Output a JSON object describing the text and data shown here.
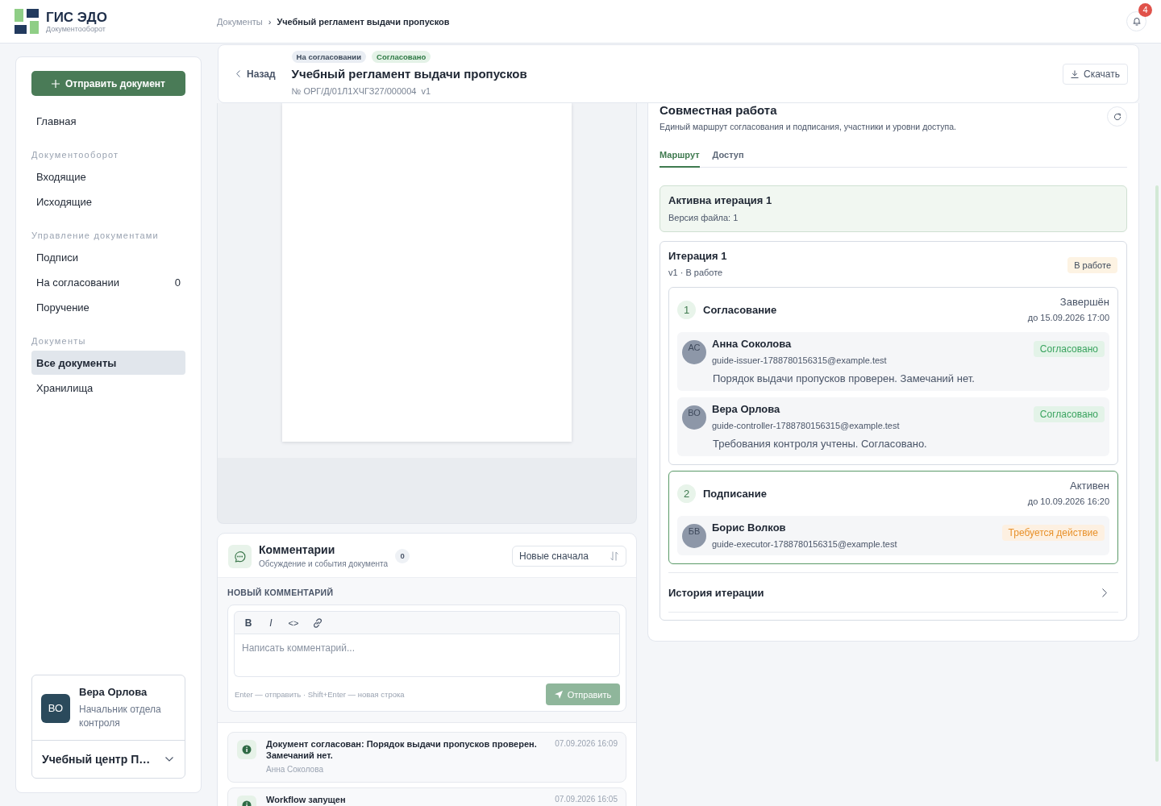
{
  "header": {
    "app_name": "ГИС ЭДО",
    "app_subtitle": "Документооборот",
    "breadcrumbs": [
      {
        "kind": "link",
        "label": "Документы"
      },
      {
        "kind": "separator",
        "label": "›"
      },
      {
        "kind": "current",
        "label": "Учебный регламент выдачи пропусков"
      }
    ],
    "notification_count": "4"
  },
  "sidebar": {
    "primary_button": "Отправить документ",
    "nav": [
      {
        "kind": "item",
        "label": "Главная",
        "selected": false
      },
      {
        "kind": "heading",
        "label": "Документооборот"
      },
      {
        "kind": "item",
        "label": "Входящие",
        "selected": false
      },
      {
        "kind": "item",
        "label": "Исходящие",
        "selected": false
      },
      {
        "kind": "heading",
        "label": "Управление документами"
      },
      {
        "kind": "item",
        "label": "Подписи",
        "selected": false
      },
      {
        "kind": "item",
        "label": "На согласовании",
        "selected": false,
        "count": "0"
      },
      {
        "kind": "item",
        "label": "Поручение",
        "selected": false
      },
      {
        "kind": "heading",
        "label": "Документы"
      },
      {
        "kind": "item",
        "label": "Все документы",
        "selected": true
      },
      {
        "kind": "item",
        "label": "Хранилища",
        "selected": false
      }
    ],
    "user": {
      "initials": "ВО",
      "name": "Вера Орлова",
      "role": "Начальник отдела контроля",
      "organization": "Учебный центр П…"
    }
  },
  "document": {
    "back_label": "Назад",
    "badges": [
      {
        "label": "На согласовании",
        "kind": "neutral"
      },
      {
        "label": "Согласовано",
        "kind": "success"
      }
    ],
    "title": "Учебный регламент выдачи пропусков",
    "number": "№ ОРГ/Д/01Л1ХЧГЗ27/000004",
    "version": "v1",
    "download_label": "Скачать"
  },
  "comments": {
    "title": "Комментарии",
    "subtitle": "Обсуждение и события документа",
    "count": "0",
    "sort": {
      "value": "Новые сначала"
    },
    "new_comment": {
      "heading": "НОВЫЙ КОММЕНТАРИЙ",
      "toolbar": [
        {
          "kind": "bold",
          "label": "B"
        },
        {
          "kind": "italic",
          "label": "I"
        },
        {
          "kind": "code",
          "label": "<>"
        },
        {
          "kind": "link"
        }
      ],
      "placeholder": "Написать комментарий...",
      "hint": "Enter — отправить · Shift+Enter — новая строка",
      "submit": {
        "label": "Отправить",
        "disabled": true
      }
    },
    "events": [
      {
        "text": "Документ согласован: Порядок выдачи пропусков проверен. Замечаний нет.",
        "author": "Анна Соколова",
        "time": "07.09.2026 16:09"
      },
      {
        "text": "Workflow запущен",
        "time": "07.09.2026 16:05"
      }
    ]
  },
  "collaboration": {
    "title": "Совместная работа",
    "subtitle": "Единый маршрут согласования и подписания, участники и уровни доступа.",
    "tabs": [
      {
        "label": "Маршрут",
        "selected": true
      },
      {
        "label": "Доступ",
        "selected": false
      }
    ],
    "active_iteration": {
      "title": "Активна итерация 1",
      "file_version": "Версия файла: 1"
    },
    "iteration": {
      "title": "Итерация 1",
      "meta": "v1 · В работе",
      "status": {
        "label": "В работе",
        "kind": "in_progress"
      },
      "stages": [
        {
          "number": "1",
          "title": "Согласование",
          "status": "Завершён",
          "deadline": "до 15.09.2026 17:00",
          "active": false,
          "participants": [
            {
              "initials": "АС",
              "name": "Анна Соколова",
              "email": "guide-issuer-1788780156315@example.test",
              "status": {
                "label": "Согласовано",
                "kind": "approved"
              },
              "comment": "Порядок выдачи пропусков проверен. Замечаний нет."
            },
            {
              "initials": "ВО",
              "name": "Вера Орлова",
              "email": "guide-controller-1788780156315@example.test",
              "status": {
                "label": "Согласовано",
                "kind": "approved"
              },
              "comment": "Требования контроля учтены. Согласовано."
            }
          ]
        },
        {
          "number": "2",
          "title": "Подписание",
          "status": "Активен",
          "deadline": "до 10.09.2026 16:20",
          "active": true,
          "participants": [
            {
              "initials": "БВ",
              "name": "Борис Волков",
              "email": "guide-executor-1788780156315@example.test",
              "status": {
                "label": "Требуется действие",
                "kind": "pending"
              }
            }
          ]
        }
      ],
      "history_label": "История итерации"
    }
  }
}
